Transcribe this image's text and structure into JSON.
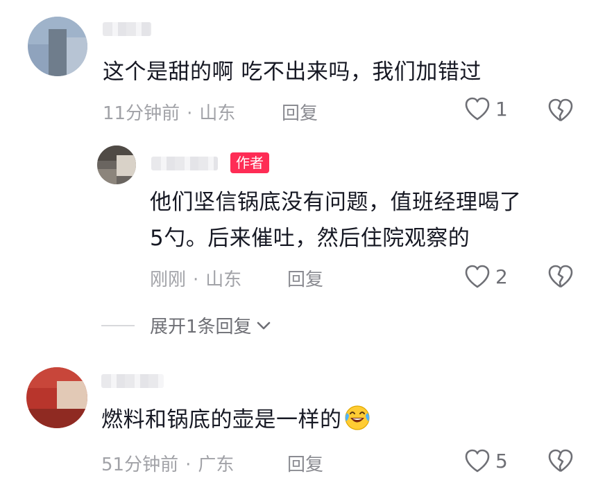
{
  "comments": [
    {
      "text": "这个是甜的啊 吃不出来吗，我们加错过",
      "time": "11分钟前",
      "location": "山东",
      "reply_label": "回复",
      "likes": "1"
    },
    {
      "author_badge": "作者",
      "text_line1": "他们坚信锅底没有问题，值班经理喝了",
      "text_line2": "5勺。后来催吐，然后住院观察的",
      "time": "刚刚",
      "location": "山东",
      "reply_label": "回复",
      "likes": "2"
    },
    {
      "text": "燃料和锅底的壶是一样的",
      "emoji": "laughing-crying-emoji",
      "time": "51分钟前",
      "location": "广东",
      "reply_label": "回复",
      "likes": "5"
    }
  ],
  "expand_replies_label": "展开1条回复",
  "colors": {
    "author_badge": "#fe2c55",
    "meta": "#a1a2a7",
    "text": "#161823"
  }
}
